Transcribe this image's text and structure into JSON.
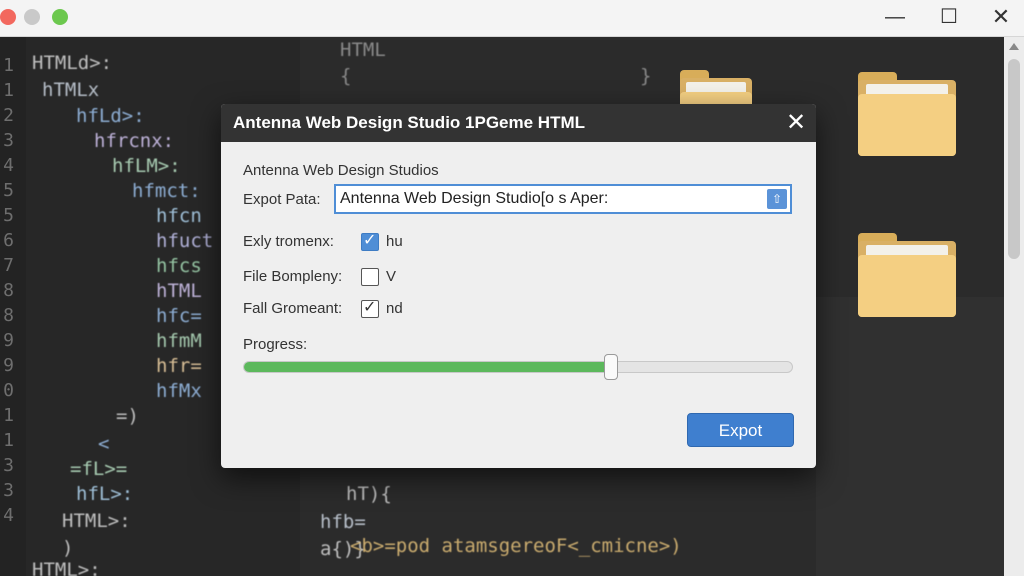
{
  "window": {
    "min_glyph": "—",
    "max_glyph": "☐",
    "close_glyph": "✕"
  },
  "editor": {
    "line_numbers": [
      "1",
      "1",
      "2",
      "3",
      "4",
      "5",
      "5",
      "6",
      "7",
      "8",
      "8",
      "9",
      "9",
      "0",
      "1",
      "1",
      "3",
      "3",
      "4"
    ],
    "left_code": [
      "HTMLd>:",
      "hTMLx",
      "hfLd>:",
      "hfrcnx:",
      "hfLM>:",
      "hfmct:",
      "hfcn",
      "hfuct",
      "hfcs",
      "hTML",
      "hfc=",
      "hfmM",
      "hfr=",
      "hfMx",
      "=)",
      "<",
      "=fL>=",
      "hfL>:",
      "HTML>:",
      ")",
      "HTML>:"
    ],
    "right_code": [
      "HTML",
      "{",
      "}",
      "hT){",
      "hfb=",
      "a{)}",
      "<b>=pod atamsgereoF<_cmicne>)"
    ]
  },
  "dialog": {
    "title": "Antenna Web Design Studio 1PGeme HTML",
    "close_glyph": "✕",
    "heading": "Antenna Web Design Studios",
    "path_label": "Expot Pata:",
    "path_value": "Antenna Web Design Studio[o s Aper:",
    "browse_glyph": "⇧",
    "options": [
      {
        "label": "Exly tromenx:",
        "checked": true,
        "style": "blue",
        "value_text": "hu",
        "check_glyph": "✓"
      },
      {
        "label": "File Bompleny:",
        "checked": false,
        "style": "plain",
        "value_text": "V",
        "check_glyph": ""
      },
      {
        "label": "Fall Gromeant:",
        "checked": true,
        "style": "plain",
        "value_text": "nd",
        "check_glyph": "✓"
      }
    ],
    "progress_label": "Progress:",
    "progress_fraction": 0.67,
    "export_label": "Expot"
  },
  "colors": {
    "accent": "#4f8ed6",
    "progress": "#5cb85c",
    "title_bar": "#333333"
  }
}
